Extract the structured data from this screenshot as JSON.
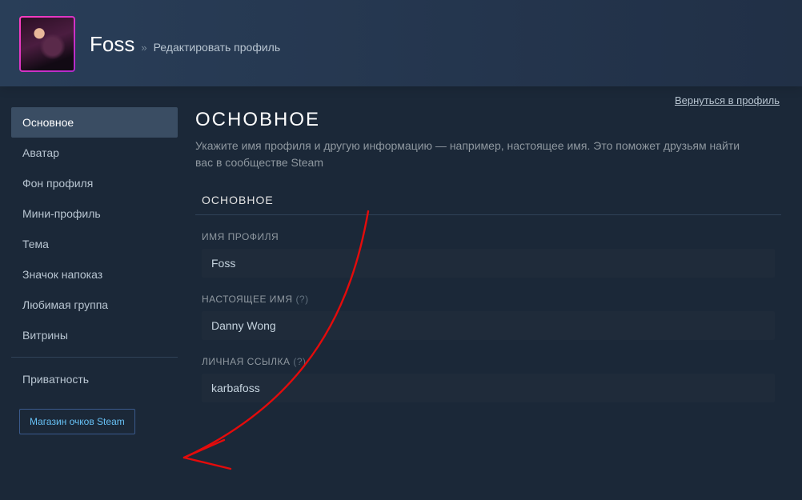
{
  "header": {
    "username": "Foss",
    "separator": "»",
    "crumb": "Редактировать профиль"
  },
  "back_link": "Вернуться в профиль",
  "sidebar": {
    "items": [
      {
        "label": "Основное",
        "active": true
      },
      {
        "label": "Аватар",
        "active": false
      },
      {
        "label": "Фон профиля",
        "active": false
      },
      {
        "label": "Мини-профиль",
        "active": false
      },
      {
        "label": "Тема",
        "active": false
      },
      {
        "label": "Значок напоказ",
        "active": false
      },
      {
        "label": "Любимая группа",
        "active": false
      },
      {
        "label": "Витрины",
        "active": false
      }
    ],
    "privacy": "Приватность",
    "points_shop": "Магазин очков Steam"
  },
  "main": {
    "title": "ОСНОВНОЕ",
    "description": "Укажите имя профиля и другую информацию — например, настоящее имя. Это поможет друзьям найти вас в сообществе Steam",
    "section_header": "ОСНОВНОЕ",
    "fields": {
      "profile_name": {
        "label": "ИМЯ ПРОФИЛЯ",
        "value": "Foss"
      },
      "real_name": {
        "label": "НАСТОЯЩЕЕ ИМЯ",
        "hint": "(?)",
        "value": "Danny Wong"
      },
      "custom_url": {
        "label": "ЛИЧНАЯ ССЫЛКА",
        "hint": "(?)",
        "value": "karbafoss"
      }
    }
  },
  "annotation_color": "#e40b0b"
}
